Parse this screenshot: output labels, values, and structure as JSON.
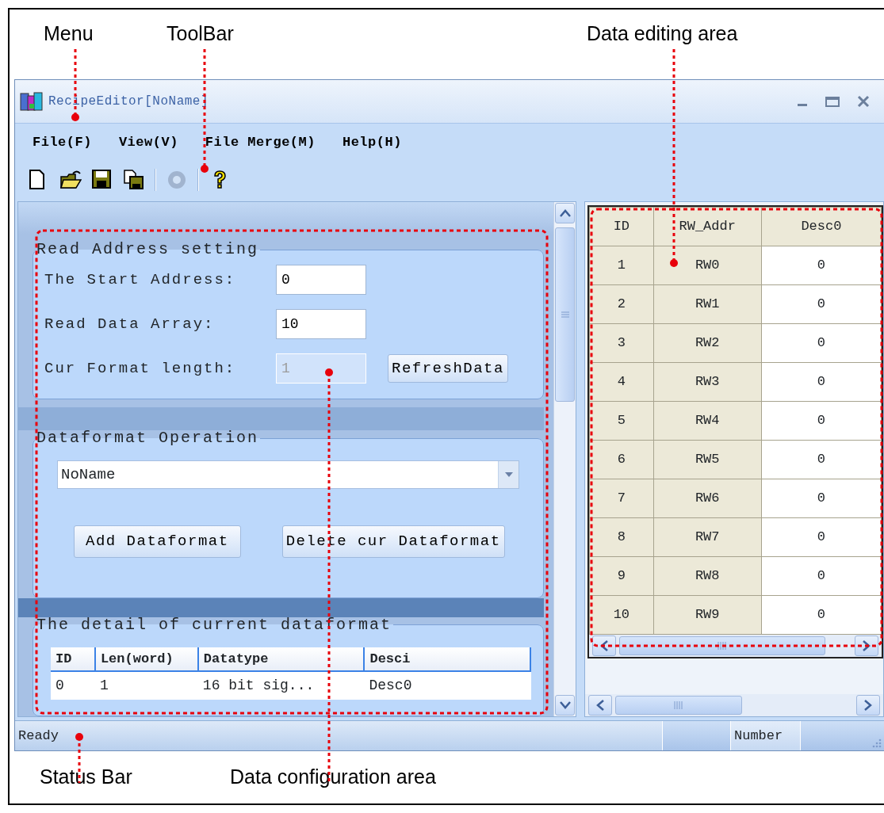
{
  "callouts": {
    "top": [
      "Menu",
      "ToolBar",
      "Data editing area"
    ],
    "bottom": [
      "Status Bar",
      "Data configuration area"
    ]
  },
  "window": {
    "title": "RecipeEditor[NoName]"
  },
  "menu": [
    "File(F)",
    "View(V)",
    "File Merge(M)",
    "Help(H)"
  ],
  "toolbar": [
    [
      {
        "kind": "new",
        "disabled": false
      },
      {
        "kind": "open",
        "disabled": false
      },
      {
        "kind": "save",
        "disabled": false
      },
      {
        "kind": "save-all",
        "disabled": false
      }
    ],
    [
      {
        "kind": "settings",
        "disabled": true
      }
    ],
    [
      {
        "kind": "help",
        "disabled": false
      }
    ]
  ],
  "read_address_setting": {
    "title": "Read Address setting",
    "fields": [
      {
        "label": "The Start Address:",
        "value": "0",
        "disabled": false
      },
      {
        "label": "Read Data Array:",
        "value": "10",
        "disabled": false
      },
      {
        "label": "Cur Format length:",
        "value": "1",
        "disabled": true
      }
    ],
    "button": "RefreshData"
  },
  "dataformat_operation": {
    "title": "Dataformat Operation",
    "dropdown": {
      "value": "NoName"
    },
    "buttons": [
      "Add Dataformat",
      "Delete cur Dataformat"
    ]
  },
  "detail": {
    "title": "The detail of current dataformat",
    "columns": [
      "ID",
      "Len(word)",
      "Datatype",
      "Desci"
    ],
    "rows": [
      [
        "0",
        "1",
        "16 bit sig...",
        "Desc0"
      ]
    ]
  },
  "data_grid": {
    "columns": [
      "ID",
      "RW_Addr",
      "Desc0"
    ],
    "rows": [
      [
        "1",
        "RW0",
        "0"
      ],
      [
        "2",
        "RW1",
        "0"
      ],
      [
        "3",
        "RW2",
        "0"
      ],
      [
        "4",
        "RW3",
        "0"
      ],
      [
        "5",
        "RW4",
        "0"
      ],
      [
        "6",
        "RW5",
        "0"
      ],
      [
        "7",
        "RW6",
        "0"
      ],
      [
        "8",
        "RW7",
        "0"
      ],
      [
        "9",
        "RW8",
        "0"
      ],
      [
        "10",
        "RW9",
        "0"
      ]
    ]
  },
  "status_bar": {
    "text": "Ready",
    "panels": [
      "Number"
    ]
  }
}
